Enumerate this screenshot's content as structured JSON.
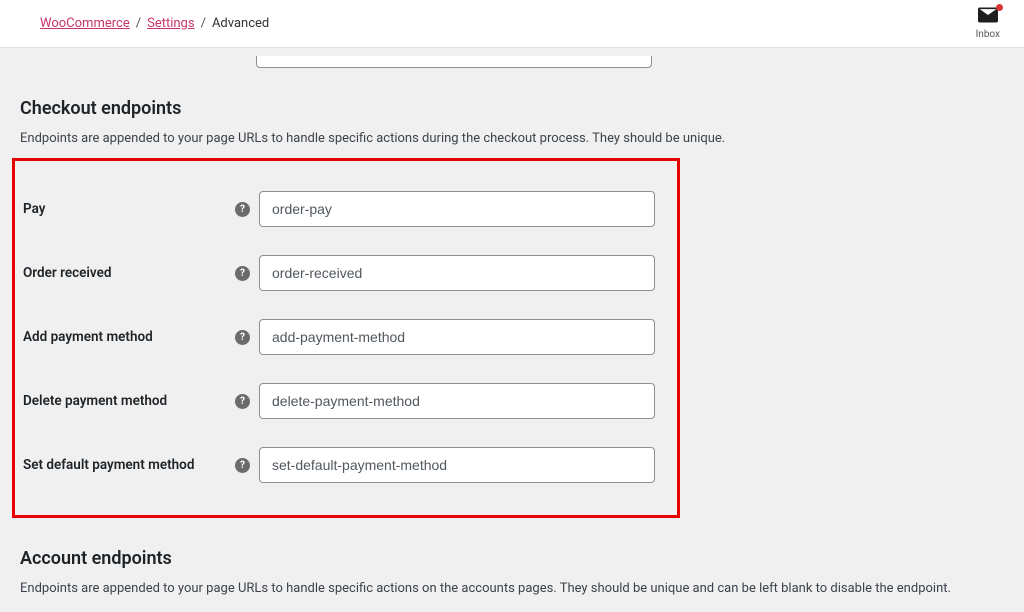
{
  "breadcrumb": {
    "parent1": "WooCommerce",
    "parent2": "Settings",
    "current": "Advanced"
  },
  "inbox": {
    "label": "Inbox"
  },
  "checkout": {
    "title": "Checkout endpoints",
    "desc": "Endpoints are appended to your page URLs to handle specific actions during the checkout process. They should be unique.",
    "fields": {
      "pay": {
        "label": "Pay",
        "value": "order-pay"
      },
      "order_received": {
        "label": "Order received",
        "value": "order-received"
      },
      "add_payment": {
        "label": "Add payment method",
        "value": "add-payment-method"
      },
      "delete_payment": {
        "label": "Delete payment method",
        "value": "delete-payment-method"
      },
      "set_default_payment": {
        "label": "Set default payment method",
        "value": "set-default-payment-method"
      }
    }
  },
  "account": {
    "title": "Account endpoints",
    "desc": "Endpoints are appended to your page URLs to handle specific actions on the accounts pages. They should be unique and can be left blank to disable the endpoint."
  }
}
